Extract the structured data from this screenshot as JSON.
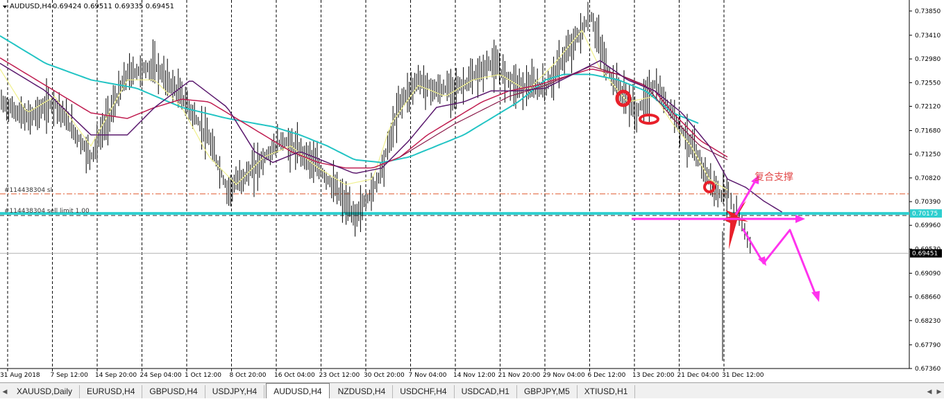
{
  "chart": {
    "symbol_label": "AUDUSD,H4",
    "ohlc_text": "0.69424 0.69511 0.69335 0.69451",
    "sl_label": "#114438304 sl",
    "order_label": "#114438304 sell limit 1.00",
    "annotation_text": "复合支撑",
    "current_price": "0.69451",
    "order_price": "0.70175",
    "price_axis": {
      "min": 0.6736,
      "max": 0.7405,
      "ticks": [
        "0.73850",
        "0.73410",
        "0.72980",
        "0.72550",
        "0.72120",
        "0.71680",
        "0.71250",
        "0.70820",
        "0.70390",
        "0.69960",
        "0.69530",
        "0.69090",
        "0.68660",
        "0.68230",
        "0.67790",
        "0.67360"
      ]
    },
    "time_labels": [
      "31 Aug 2018",
      "7 Sep 12:00",
      "14 Sep 20:00",
      "24 Sep 04:00",
      "1 Oct 12:00",
      "8 Oct 20:00",
      "16 Oct 04:00",
      "23 Oct 12:00",
      "30 Oct 20:00",
      "7 Nov 04:00",
      "14 Nov 12:00",
      "21 Nov 20:00",
      "29 Nov 04:00",
      "6 Dec 12:00",
      "13 Dec 20:00",
      "21 Dec 04:00",
      "31 Dec 12:00"
    ],
    "levels": {
      "sl": 0.7053,
      "order": 0.70175,
      "current": 0.69451
    },
    "colors": {
      "bars": "#000000",
      "ma_fast": "#f0f08c",
      "ma_purple": "#5b1a6e",
      "ma_crimson": "#c01d50",
      "ma_teal": "#22c4c4",
      "order_line": "#2ecfcf",
      "sl_line": "#e0562a",
      "annotation": "#ff33ee",
      "circle": "#e8202a",
      "price_tag": "#2ecfcf"
    },
    "series_anchors": {
      "price": [
        [
          0,
          0.722
        ],
        [
          0.03,
          0.719
        ],
        [
          0.06,
          0.722
        ],
        [
          0.1,
          0.712
        ],
        [
          0.14,
          0.727
        ],
        [
          0.17,
          0.7285
        ],
        [
          0.2,
          0.723
        ],
        [
          0.23,
          0.715
        ],
        [
          0.25,
          0.706
        ],
        [
          0.28,
          0.71
        ],
        [
          0.31,
          0.715
        ],
        [
          0.34,
          0.712
        ],
        [
          0.37,
          0.706
        ],
        [
          0.39,
          0.701
        ],
        [
          0.41,
          0.706
        ],
        [
          0.42,
          0.71
        ],
        [
          0.44,
          0.722
        ],
        [
          0.46,
          0.726
        ],
        [
          0.48,
          0.724
        ],
        [
          0.51,
          0.725
        ],
        [
          0.54,
          0.729
        ],
        [
          0.57,
          0.725
        ],
        [
          0.6,
          0.7245
        ],
        [
          0.62,
          0.73
        ],
        [
          0.65,
          0.7375
        ],
        [
          0.67,
          0.727
        ],
        [
          0.7,
          0.72
        ],
        [
          0.72,
          0.725
        ],
        [
          0.74,
          0.72
        ],
        [
          0.76,
          0.714
        ],
        [
          0.79,
          0.705
        ],
        [
          0.82,
          0.706
        ],
        [
          0.84,
          0.701
        ],
        [
          0.85,
          0.7
        ],
        [
          0.86,
          0.696
        ],
        [
          0.87,
          0.6945
        ]
      ],
      "ma_purple": [
        [
          0,
          0.729
        ],
        [
          0.05,
          0.724
        ],
        [
          0.1,
          0.716
        ],
        [
          0.14,
          0.716
        ],
        [
          0.17,
          0.721
        ],
        [
          0.21,
          0.726
        ],
        [
          0.25,
          0.721
        ],
        [
          0.28,
          0.713
        ],
        [
          0.3,
          0.711
        ],
        [
          0.33,
          0.713
        ],
        [
          0.36,
          0.711
        ],
        [
          0.39,
          0.709
        ],
        [
          0.42,
          0.71
        ],
        [
          0.45,
          0.715
        ],
        [
          0.48,
          0.721
        ],
        [
          0.51,
          0.722
        ],
        [
          0.54,
          0.724
        ],
        [
          0.57,
          0.724
        ],
        [
          0.6,
          0.7245
        ],
        [
          0.63,
          0.727
        ],
        [
          0.66,
          0.7295
        ],
        [
          0.69,
          0.726
        ],
        [
          0.72,
          0.724
        ],
        [
          0.75,
          0.72
        ],
        [
          0.78,
          0.714
        ],
        [
          0.8,
          0.708
        ],
        [
          0.82,
          0.7065
        ],
        [
          0.84,
          0.704
        ],
        [
          0.86,
          0.702
        ]
      ],
      "ma_crimson": [
        [
          0,
          0.73
        ],
        [
          0.05,
          0.725
        ],
        [
          0.1,
          0.72
        ],
        [
          0.14,
          0.719
        ],
        [
          0.17,
          0.721
        ],
        [
          0.2,
          0.7225
        ],
        [
          0.23,
          0.722
        ],
        [
          0.26,
          0.719
        ],
        [
          0.29,
          0.716
        ],
        [
          0.32,
          0.713
        ],
        [
          0.35,
          0.711
        ],
        [
          0.38,
          0.71
        ],
        [
          0.41,
          0.71
        ],
        [
          0.44,
          0.712
        ],
        [
          0.47,
          0.716
        ],
        [
          0.5,
          0.719
        ],
        [
          0.53,
          0.722
        ],
        [
          0.56,
          0.724
        ],
        [
          0.59,
          0.725
        ],
        [
          0.62,
          0.7265
        ],
        [
          0.65,
          0.728
        ],
        [
          0.68,
          0.727
        ],
        [
          0.7,
          0.7255
        ],
        [
          0.72,
          0.724
        ],
        [
          0.74,
          0.72
        ],
        [
          0.77,
          0.715
        ],
        [
          0.8,
          0.712
        ]
      ],
      "ma_dark2": [
        [
          0.44,
          0.712
        ],
        [
          0.5,
          0.718
        ],
        [
          0.56,
          0.723
        ],
        [
          0.6,
          0.725
        ],
        [
          0.65,
          0.7285
        ],
        [
          0.68,
          0.727
        ],
        [
          0.71,
          0.725
        ],
        [
          0.74,
          0.719
        ],
        [
          0.77,
          0.714
        ],
        [
          0.8,
          0.7115
        ]
      ],
      "ma_teal": [
        [
          0,
          0.734
        ],
        [
          0.05,
          0.729
        ],
        [
          0.1,
          0.726
        ],
        [
          0.15,
          0.7245
        ],
        [
          0.2,
          0.721
        ],
        [
          0.25,
          0.719
        ],
        [
          0.3,
          0.7175
        ],
        [
          0.33,
          0.716
        ],
        [
          0.36,
          0.714
        ],
        [
          0.39,
          0.7115
        ],
        [
          0.42,
          0.711
        ],
        [
          0.45,
          0.712
        ],
        [
          0.48,
          0.714
        ],
        [
          0.51,
          0.716
        ],
        [
          0.54,
          0.719
        ],
        [
          0.57,
          0.722
        ],
        [
          0.6,
          0.726
        ],
        [
          0.62,
          0.727
        ],
        [
          0.65,
          0.727
        ],
        [
          0.68,
          0.726
        ],
        [
          0.71,
          0.724
        ],
        [
          0.74,
          0.72
        ],
        [
          0.77,
          0.718
        ]
      ],
      "ma_fast": [
        [
          0,
          0.728
        ],
        [
          0.03,
          0.72
        ],
        [
          0.06,
          0.723
        ],
        [
          0.1,
          0.714
        ],
        [
          0.14,
          0.726
        ],
        [
          0.17,
          0.726
        ],
        [
          0.2,
          0.721
        ],
        [
          0.23,
          0.712
        ],
        [
          0.26,
          0.707
        ],
        [
          0.29,
          0.712
        ],
        [
          0.32,
          0.714
        ],
        [
          0.35,
          0.71
        ],
        [
          0.38,
          0.707
        ],
        [
          0.41,
          0.708
        ],
        [
          0.43,
          0.718
        ],
        [
          0.46,
          0.725
        ],
        [
          0.49,
          0.723
        ],
        [
          0.52,
          0.726
        ],
        [
          0.55,
          0.727
        ],
        [
          0.58,
          0.724
        ],
        [
          0.61,
          0.729
        ],
        [
          0.64,
          0.735
        ],
        [
          0.66,
          0.728
        ],
        [
          0.69,
          0.722
        ],
        [
          0.72,
          0.723
        ],
        [
          0.74,
          0.718
        ],
        [
          0.76,
          0.714
        ],
        [
          0.78,
          0.708
        ],
        [
          0.8,
          0.706
        ]
      ]
    },
    "spike_low": 0.675
  },
  "tabs": [
    {
      "label": "XAUUSD,Daily",
      "active": false
    },
    {
      "label": "EURUSD,H4",
      "active": false
    },
    {
      "label": "GBPUSD,H4",
      "active": false
    },
    {
      "label": "USDJPY,H4",
      "active": false
    },
    {
      "label": "AUDUSD,H4",
      "active": true
    },
    {
      "label": "NZDUSD,H4",
      "active": false
    },
    {
      "label": "USDCHF,H4",
      "active": false
    },
    {
      "label": "USDCAD,H1",
      "active": false
    },
    {
      "label": "GBPJPY,M5",
      "active": false
    },
    {
      "label": "XTIUSD,H1",
      "active": false
    }
  ]
}
